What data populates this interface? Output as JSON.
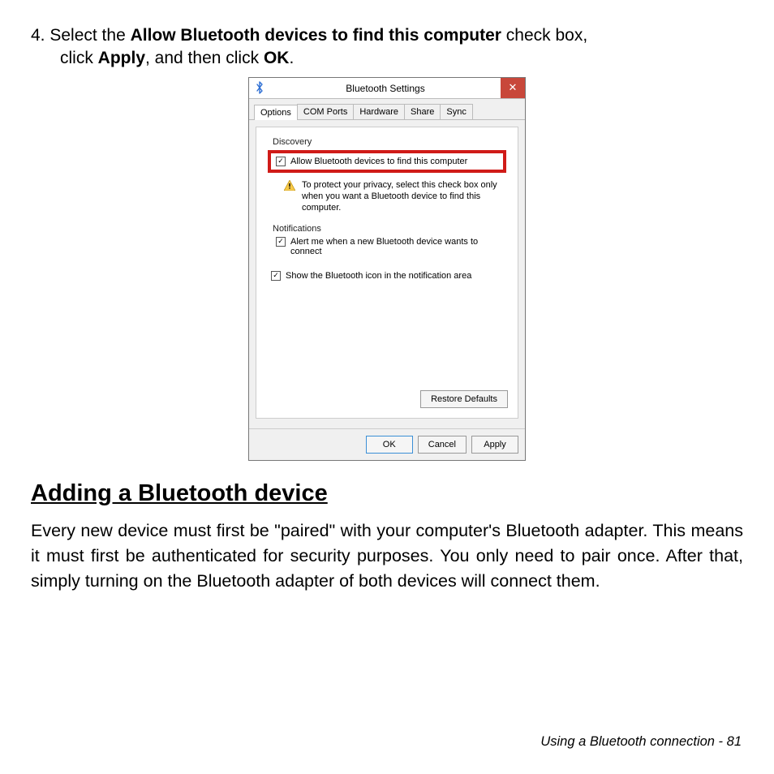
{
  "step": {
    "number": "4.",
    "part1": " Select the ",
    "bold1": "Allow Bluetooth devices to find this computer",
    "part2": " check box,",
    "part3": "click ",
    "bold2": "Apply",
    "part4": ", and then click ",
    "bold3": "OK",
    "part5": "."
  },
  "dialog": {
    "title": "Bluetooth Settings",
    "close": "✕",
    "tabs": [
      "Options",
      "COM Ports",
      "Hardware",
      "Share",
      "Sync"
    ],
    "discovery_label": "Discovery",
    "allow_label": "Allow Bluetooth devices to find this computer",
    "warning": "To protect your privacy, select this check box only when you want a Bluetooth device to find this computer.",
    "notifications_label": "Notifications",
    "alert_label": "Alert me when a new Bluetooth device wants to connect",
    "showicon_label": "Show the Bluetooth icon in the notification area",
    "restore": "Restore Defaults",
    "ok": "OK",
    "cancel": "Cancel",
    "apply": "Apply"
  },
  "section_heading": "Adding a Bluetooth device",
  "section_body": "Every new device must first be \"paired\" with your computer's Bluetooth adapter. This means it must first be authenticated for security purposes. You only need to pair once. After that, simply turning on the Bluetooth adapter of both devices will connect them.",
  "footer": "Using a Bluetooth connection -  81"
}
